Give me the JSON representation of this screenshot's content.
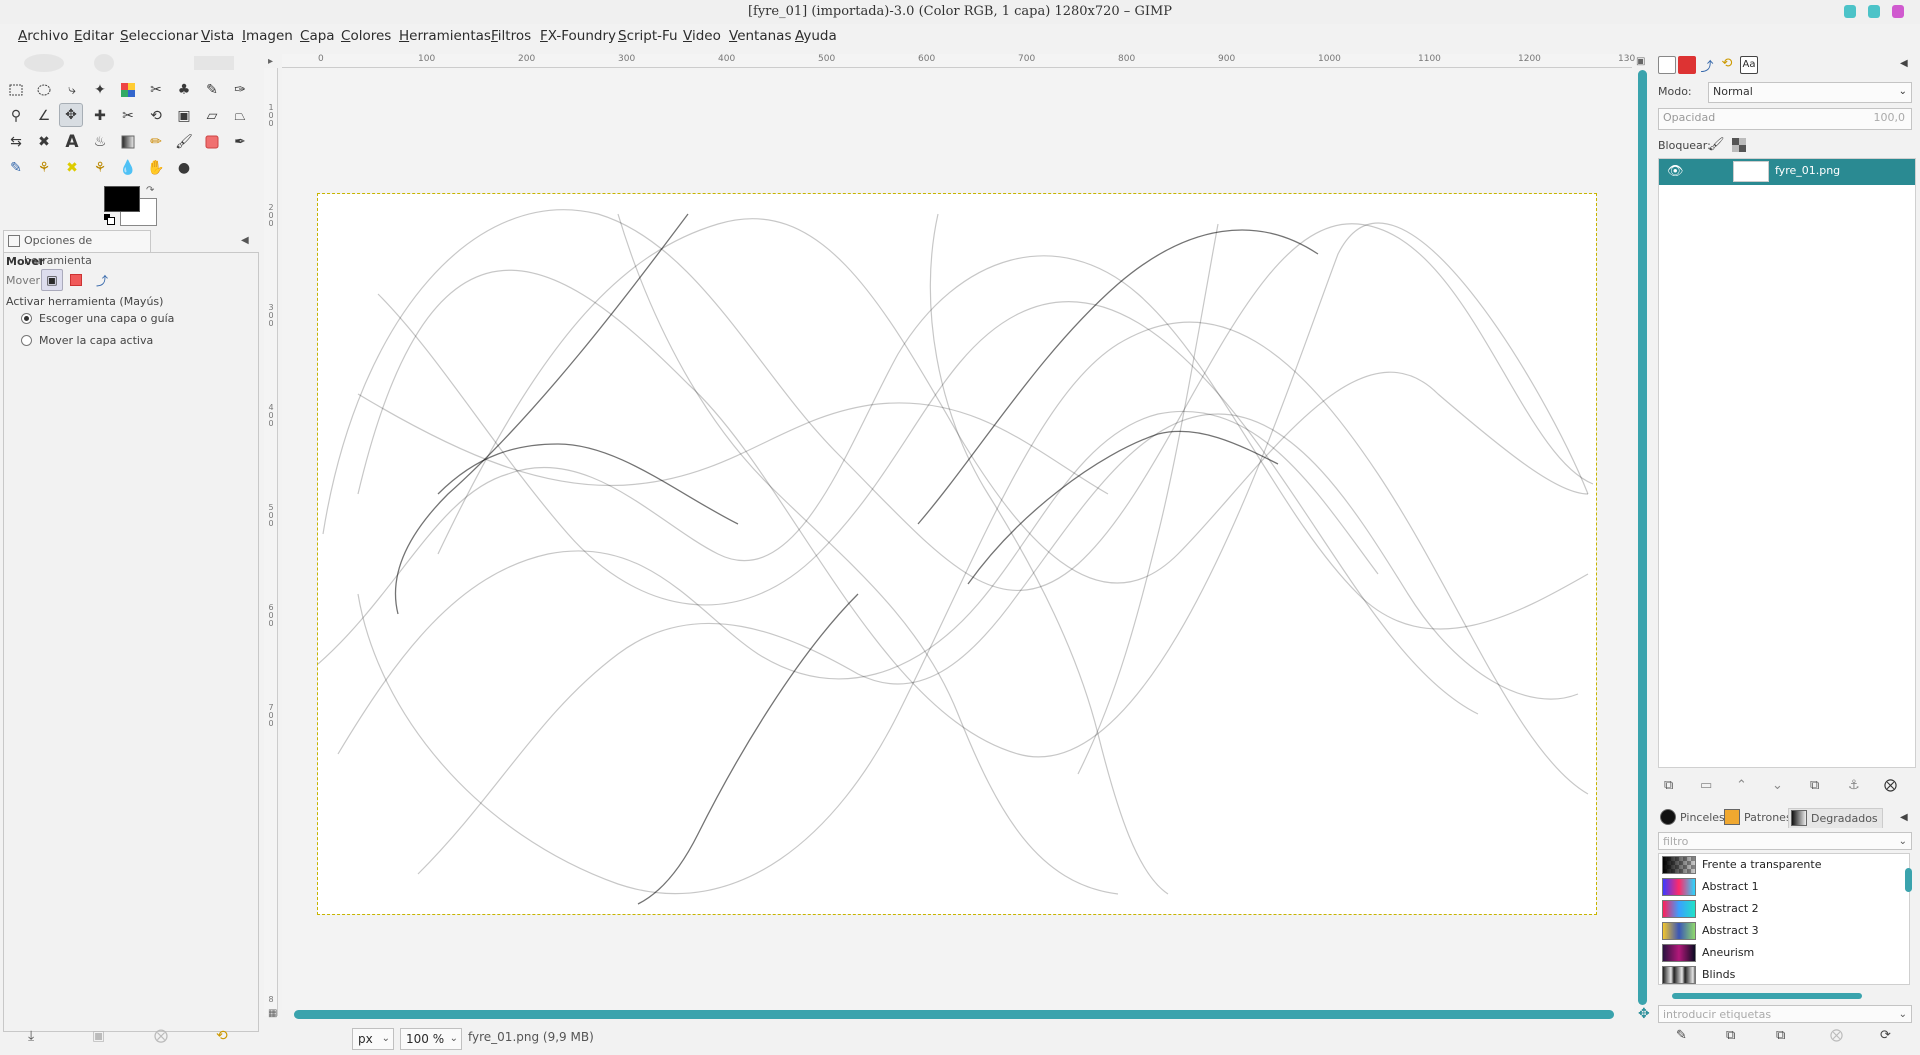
{
  "window": {
    "title": "[fyre_01] (importada)-3.0 (Color RGB, 1 capa) 1280x720 – GIMP"
  },
  "menubar": {
    "items": [
      "Archivo",
      "Editar",
      "Seleccionar",
      "Vista",
      "Imagen",
      "Capa",
      "Colores",
      "Herramientas",
      "Filtros",
      "FX-Foundry",
      "Script-Fu",
      "Video",
      "Ventanas",
      "Ayuda"
    ]
  },
  "toolbox": {
    "tools": [
      "rect-select-icon",
      "ellipse-select-icon",
      "free-select-icon",
      "fuzzy-select-icon",
      "color-select-icon",
      "scissors-select-icon",
      "foreground-select-icon",
      "paths-icon",
      "color-picker-icon",
      "zoom-icon",
      "measure-icon",
      "move-icon",
      "align-icon",
      "crop-icon",
      "rotate-icon",
      "scale-icon",
      "shear-icon",
      "perspective-icon",
      "flip-icon",
      "cage-icon",
      "text-icon",
      "bucket-fill-icon",
      "blend-icon",
      "pencil-icon",
      "paintbrush-icon",
      "eraser-icon",
      "airbrush-icon",
      "ink-icon",
      "clone-icon",
      "heal-icon",
      "perspective-clone-icon",
      "blur-icon",
      "smudge-icon",
      "dodge-burn-icon"
    ],
    "active_tool": "move-icon",
    "foreground_color": "#000000",
    "background_color": "#ffffff"
  },
  "tool_options": {
    "tab_label": "Opciones de herramienta",
    "tool_name": "Mover",
    "move_label": "Mover:",
    "activate_label": "Activar herramienta  (Mayús)",
    "options": [
      {
        "label": "Escoger una capa o guía",
        "selected": true
      },
      {
        "label": "Mover la capa activa",
        "selected": false
      }
    ]
  },
  "canvas": {
    "ruler_marks": [
      "0",
      "100",
      "200",
      "300",
      "400",
      "500",
      "600",
      "700",
      "800",
      "900",
      "1000",
      "1100",
      "1200",
      "130"
    ],
    "ruler_vmarks": [
      "100",
      "200",
      "300",
      "400",
      "500",
      "600",
      "700",
      "8"
    ],
    "image_size": "1280x720"
  },
  "statusbar": {
    "unit": "px",
    "zoom": "100 %",
    "info": "fyre_01.png (9,9 MB)"
  },
  "layers": {
    "mode_label": "Modo:",
    "mode_value": "Normal",
    "opacity_label": "Opacidad",
    "opacity_value": "100,0",
    "lock_label": "Bloquear:",
    "layer_name": "fyre_01.png"
  },
  "bottom_dock": {
    "tabs": [
      "Pinceles",
      "Patrones",
      "Degradados"
    ],
    "filter_placeholder": "filtro",
    "tag_placeholder": "introducir etiquetas",
    "gradients": [
      {
        "name": "Frente a transparente",
        "colors": [
          "#000000",
          "#ffffff"
        ]
      },
      {
        "name": "Abstract 1",
        "colors": [
          "#3b3bff",
          "#ff2a6a",
          "#2ad6ff"
        ]
      },
      {
        "name": "Abstract 2",
        "colors": [
          "#ff1f5a",
          "#3aa0ff",
          "#21e2c8"
        ]
      },
      {
        "name": "Abstract 3",
        "colors": [
          "#f2c62e",
          "#3a56b7",
          "#8fd96b"
        ]
      },
      {
        "name": "Aneurism",
        "colors": [
          "#2a1340",
          "#b2187a",
          "#0b0b22"
        ]
      },
      {
        "name": "Blinds",
        "colors": [
          "#222222",
          "#e6e6e6",
          "#222222"
        ]
      }
    ]
  }
}
